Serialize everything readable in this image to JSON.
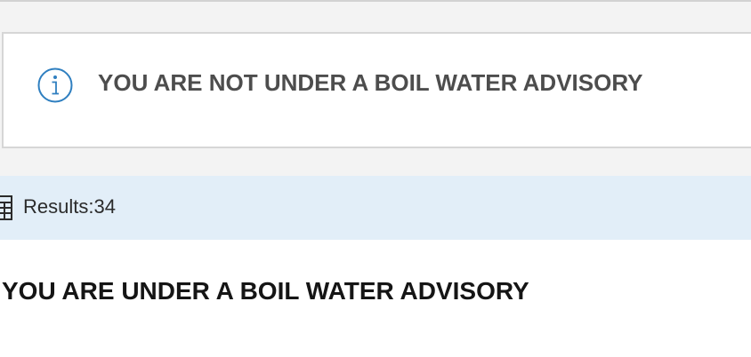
{
  "advisory_card": {
    "icon": "info-icon",
    "message": "YOU ARE NOT UNDER A BOIL WATER ADVISORY"
  },
  "results_bar": {
    "icon": "table-list-icon",
    "label": "Results:",
    "count": "34"
  },
  "list": {
    "title": "YOU ARE UNDER A BOIL WATER ADVISORY"
  },
  "colors": {
    "top_background": "#f3f3f3",
    "card_border": "#d6d6d6",
    "info_icon": "#2f7fc0",
    "results_background": "#e2eef8",
    "advisory_text": "#4d4d4d",
    "title_text": "#151515"
  }
}
